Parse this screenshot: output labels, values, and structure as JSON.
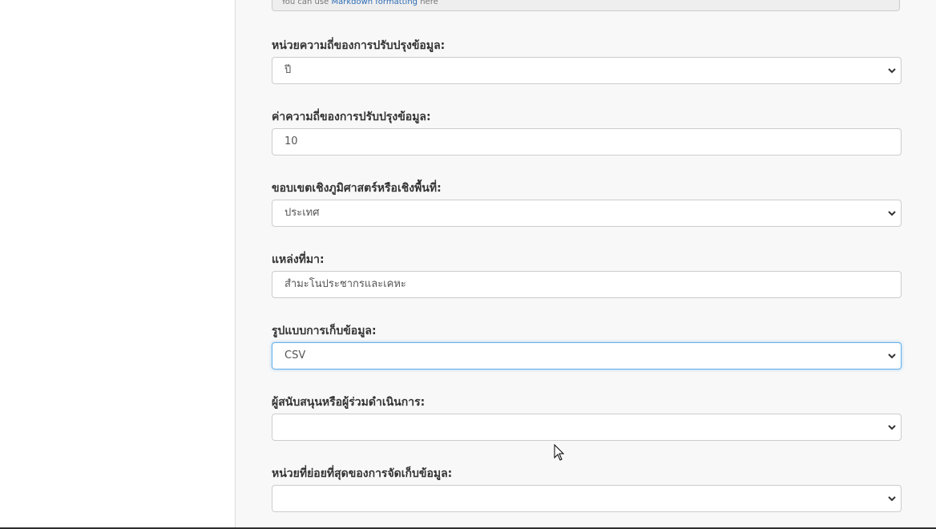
{
  "markdown_help": {
    "prefix": "You can use",
    "link": "Markdown formatting",
    "suffix": "here"
  },
  "fields": [
    {
      "label": "หน่วยความถี่ของการปรับปรุงข้อมูล:",
      "value": "ปี",
      "type": "select"
    },
    {
      "label": "ค่าความถี่ของการปรับปรุงข้อมูล:",
      "value": "10",
      "type": "input"
    },
    {
      "label": "ขอบเขตเชิงภูมิศาสตร์หรือเชิงพื้นที่:",
      "value": "ประเทศ",
      "type": "select"
    },
    {
      "label": "แหล่งที่มา:",
      "value": "สำมะโนประชากรและเคหะ",
      "type": "input"
    },
    {
      "label": "รูปแบบการเก็บข้อมูล:",
      "value": "CSV",
      "type": "select",
      "focused": true
    },
    {
      "label": "ผู้สนับสนุนหรือผู้ร่วมดำเนินการ:",
      "value": "",
      "type": "select"
    },
    {
      "label": "หน่วยที่ย่อยที่สุดของการจัดเก็บข้อมูล:",
      "value": "",
      "type": "select"
    }
  ],
  "icons": {
    "select_arrow": "chevron-down-icon",
    "pointer": "mouse-cursor-icon"
  },
  "colors": {
    "focus_border": "#66afe9",
    "link": "#2d6db5"
  }
}
